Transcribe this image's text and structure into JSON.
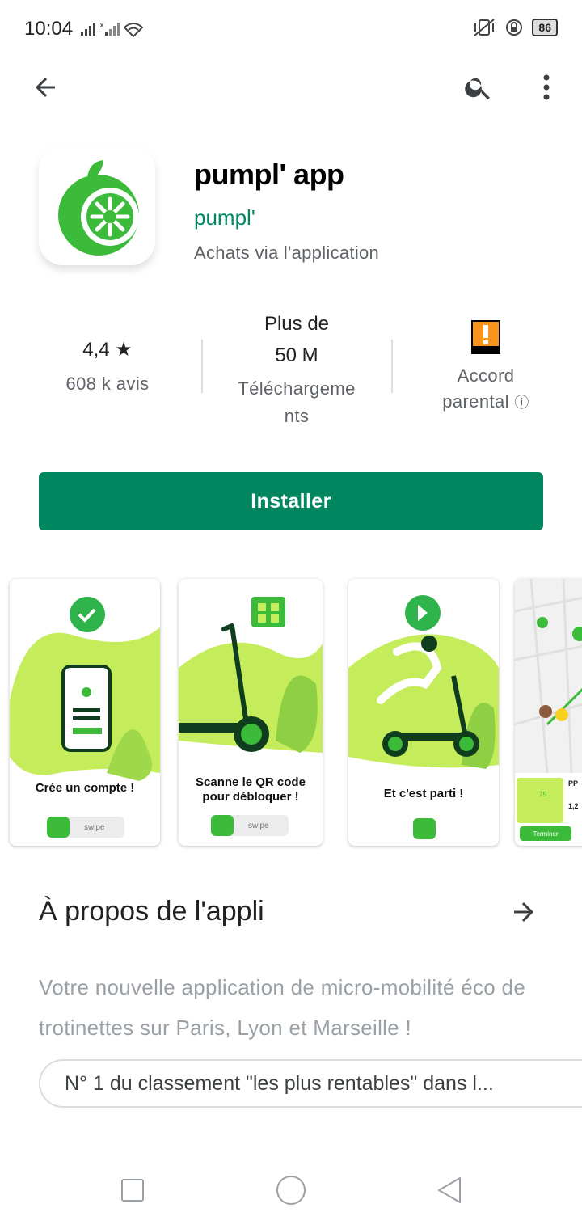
{
  "status_bar": {
    "time": "10:04",
    "battery": "86"
  },
  "app": {
    "title": "pumpl' app",
    "developer": "pumpl'",
    "in_app_purchases": "Achats via l'application"
  },
  "stats": {
    "rating": "4,4",
    "rating_star": "★",
    "reviews": "608 k avis",
    "downloads_line1": "Plus de",
    "downloads_line2": "50 M",
    "downloads_label_line1": "Téléchargeme",
    "downloads_label_line2": "nts",
    "content_rating_line1": "Accord",
    "content_rating_line2": "parental",
    "info_icon": "ⓘ"
  },
  "install_label": "Installer",
  "screenshots": [
    {
      "caption_line1": "Crée un compte !",
      "caption_line2": "",
      "swipe": "swipe"
    },
    {
      "caption_line1": "Scanne le QR code",
      "caption_line2": "pour débloquer !",
      "swipe": "swipe"
    },
    {
      "caption_line1": "Et c'est parti !",
      "caption_line2": "",
      "swipe": ""
    },
    {
      "caption_line1": "",
      "caption_line2": "",
      "label_pp": "PP",
      "value_1": "1,2",
      "badge_75": "75",
      "terminer": "Terminer"
    }
  ],
  "about": {
    "title": "À propos de l'appli",
    "description": "Votre nouvelle application de micro-mobilité éco de trotinettes sur Paris, Lyon et Marseille !",
    "chip": "N° 1 du classement \"les plus rentables\" dans l..."
  },
  "colors": {
    "accent": "#01875f",
    "brand_green": "#3cbb3b",
    "lime": "#b5e55a",
    "dark_green": "#0f3d1e"
  }
}
